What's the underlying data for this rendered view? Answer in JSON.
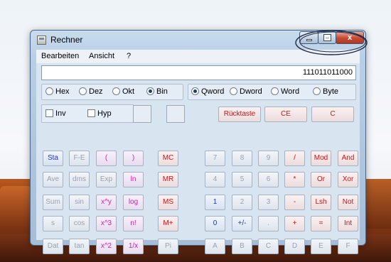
{
  "window": {
    "title": "Rechner",
    "close_glyph": "x"
  },
  "menu": [
    "Bearbeiten",
    "Ansicht",
    "?"
  ],
  "display": {
    "value": "111011011000"
  },
  "base_group": {
    "options": [
      "Hex",
      "Dez",
      "Okt",
      "Bin"
    ],
    "selected": "Bin"
  },
  "word_group": {
    "options": [
      "Qword",
      "Dword",
      "Word",
      "Byte"
    ],
    "selected": "Qword"
  },
  "checks": {
    "inv": "Inv",
    "hyp": "Hyp"
  },
  "top_keys": {
    "backspace": "Rücktaste",
    "ce": "CE",
    "c": "C"
  },
  "keys": [
    [
      "Sta",
      "F-E",
      "(",
      ")",
      "MC",
      "7",
      "8",
      "9",
      "/",
      "Mod",
      "And"
    ],
    [
      "Ave",
      "dms",
      "Exp",
      "ln",
      "MR",
      "4",
      "5",
      "6",
      "*",
      "Or",
      "Xor"
    ],
    [
      "Sum",
      "sin",
      "x^y",
      "log",
      "MS",
      "1",
      "2",
      "3",
      "-",
      "Lsh",
      "Not"
    ],
    [
      "s",
      "cos",
      "x^3",
      "n!",
      "M+",
      "0",
      "+/-",
      ".",
      "+",
      "=",
      "Int"
    ],
    [
      "Dat",
      "tan",
      "x^2",
      "1/x",
      "Pi",
      "A",
      "B",
      "C",
      "D",
      "E",
      "F"
    ]
  ],
  "colors": {
    "enabled_blue": "#1c38b3",
    "function_magenta": "#d41ba8",
    "memory_red": "#c6151a",
    "disabled_gray": "#9aa2ad",
    "ink_circle": "#1e2a44"
  }
}
